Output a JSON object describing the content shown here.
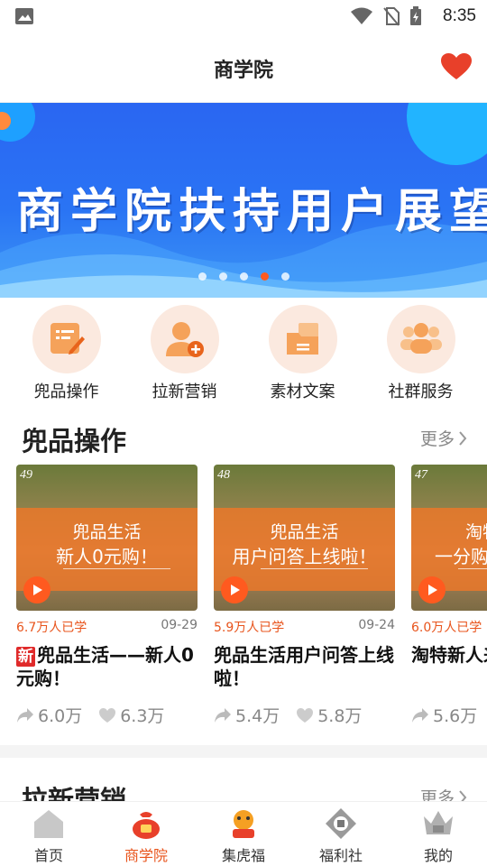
{
  "status": {
    "time": "8:35"
  },
  "header": {
    "title": "商学院"
  },
  "banner": {
    "text": "商学院扶持用户展望",
    "dot_count": 5,
    "active_dot": 3
  },
  "quick_menu": [
    {
      "label": "兜品操作",
      "icon": "edit-doc-icon"
    },
    {
      "label": "拉新营销",
      "icon": "add-user-icon"
    },
    {
      "label": "素材文案",
      "icon": "folder-icon"
    },
    {
      "label": "社群服务",
      "icon": "group-icon"
    }
  ],
  "section1": {
    "title": "兜品操作",
    "more": "更多"
  },
  "cards": [
    {
      "num": "49",
      "thumb_line1": "兜品生活",
      "thumb_line2": "新人0元购！",
      "learners": "6.7万人已学",
      "date": "09-29",
      "tag": "新",
      "title": "兜品生活——新人0元购！",
      "shares": "6.0万",
      "likes": "6.3万"
    },
    {
      "num": "48",
      "thumb_line1": "兜品生活",
      "thumb_line2": "用户问答上线啦！",
      "learners": "5.9万人已学",
      "date": "09-24",
      "tag": "",
      "title": "兜品生活用户问答上线啦！",
      "shares": "5.4万",
      "likes": "5.8万"
    },
    {
      "num": "47",
      "thumb_line1": "淘特",
      "thumb_line2": "一分购",
      "learners": "6.0万人已学",
      "date": "",
      "tag": "",
      "title": "淘特新人来啦！",
      "shares": "5.6万",
      "likes": ""
    }
  ],
  "section2": {
    "title": "拉新营销",
    "more": "更多"
  },
  "bottom_nav": [
    {
      "label": "首页",
      "icon": "home-icon",
      "active": false
    },
    {
      "label": "商学院",
      "icon": "money-bag-icon",
      "active": true
    },
    {
      "label": "集虎福",
      "icon": "tiger-icon",
      "active": false
    },
    {
      "label": "福利社",
      "icon": "welfare-icon",
      "active": false
    },
    {
      "label": "我的",
      "icon": "crown-icon",
      "active": false
    }
  ],
  "colors": {
    "accent": "#e8541c",
    "banner_blue": "#2a6ef3",
    "heart_red": "#e8402a"
  }
}
